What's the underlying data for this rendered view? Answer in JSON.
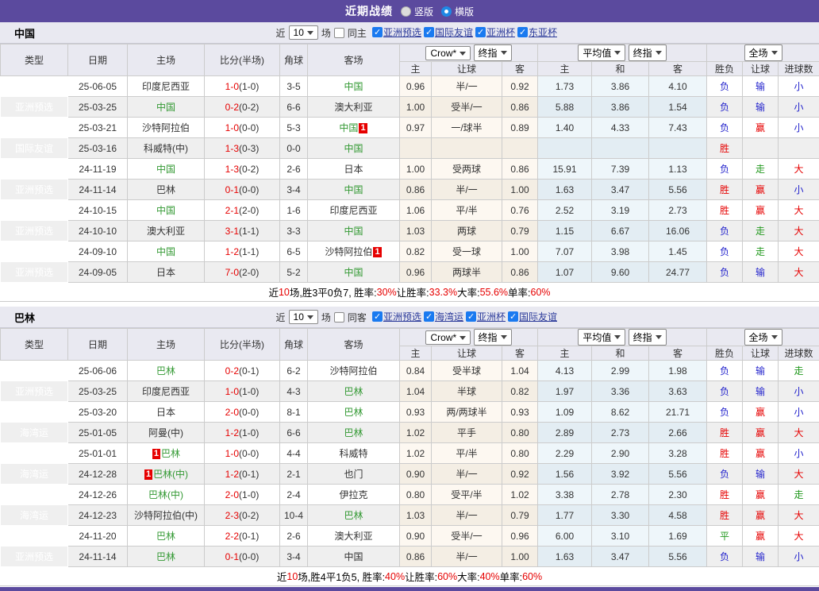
{
  "topbar": {
    "title": "近期战绩",
    "layout_options": [
      {
        "label": "竖版",
        "selected": false
      },
      {
        "label": "横版",
        "selected": true
      }
    ]
  },
  "labels": {
    "col_type": "类型",
    "col_date": "日期",
    "col_home": "主场",
    "col_score": "比分(半场)",
    "col_corner": "角球",
    "col_away": "客场",
    "odds_company_select": "Crow*",
    "odds_time_select": "终指",
    "avg_type_select": "平均值",
    "avg_time_select": "终指",
    "scope_select": "全场",
    "sub_home": "主",
    "sub_handicap": "让球",
    "sub_away": "客",
    "sub_avg_home": "主",
    "sub_avg_draw": "和",
    "sub_avg_away": "客",
    "res_outcome": "胜负",
    "res_handicap": "让球",
    "res_goals": "进球数"
  },
  "colors": {
    "header_purple": "#5b4a9e",
    "comp_green": "#4cae4c",
    "comp_blue": "#5b74bd",
    "comp_darkred": "#a52a2a",
    "team_green": "#339933",
    "win_red": "#e60000",
    "loss_blue": "#2222cc",
    "draw_green": "#22991e",
    "checkbox_blue": "#1a7af0"
  },
  "sections": [
    {
      "team": "中国",
      "filter": {
        "near": "近",
        "games": "10",
        "suffix": "场",
        "same_label": "同主",
        "same_checked": false,
        "competitions": [
          "亚洲预选",
          "国际友谊",
          "亚洲杯",
          "东亚杯"
        ]
      },
      "rows": [
        {
          "comp": "亚洲预选",
          "comp_color": "green",
          "date": "25-06-05",
          "home": {
            "name": "印度尼西亚",
            "hl": false
          },
          "score": "1-0",
          "half": "(1-0)",
          "corners": "3-5",
          "away": {
            "name": "中国",
            "hl": true
          },
          "odds": [
            "0.96",
            "半/一",
            "0.92"
          ],
          "avg": [
            "1.73",
            "3.86",
            "4.10"
          ],
          "results": [
            [
              "负",
              "b"
            ],
            [
              "输",
              "b"
            ],
            [
              "小",
              "b"
            ]
          ]
        },
        {
          "comp": "亚洲预选",
          "comp_color": "green",
          "date": "25-03-25",
          "home": {
            "name": "中国",
            "hl": true
          },
          "score": "0-2",
          "half": "(0-2)",
          "corners": "6-6",
          "away": {
            "name": "澳大利亚",
            "hl": false
          },
          "odds": [
            "1.00",
            "受半/一",
            "0.86"
          ],
          "avg": [
            "5.88",
            "3.86",
            "1.54"
          ],
          "results": [
            [
              "负",
              "b"
            ],
            [
              "输",
              "b"
            ],
            [
              "小",
              "b"
            ]
          ]
        },
        {
          "comp": "亚洲预选",
          "comp_color": "green",
          "date": "25-03-21",
          "home": {
            "name": "沙特阿拉伯",
            "hl": false
          },
          "score": "1-0",
          "half": "(0-0)",
          "corners": "5-3",
          "away": {
            "name": "中国",
            "hl": true,
            "badge": "1",
            "badge_pos": "after"
          },
          "odds": [
            "0.97",
            "一/球半",
            "0.89"
          ],
          "avg": [
            "1.40",
            "4.33",
            "7.43"
          ],
          "results": [
            [
              "负",
              "b"
            ],
            [
              "赢",
              "r"
            ],
            [
              "小",
              "b"
            ]
          ]
        },
        {
          "comp": "国际友谊",
          "comp_color": "blue",
          "date": "25-03-16",
          "home": {
            "name": "科威特(中)",
            "hl": false
          },
          "score": "1-3",
          "half": "(0-3)",
          "corners": "0-0",
          "away": {
            "name": "中国",
            "hl": true
          },
          "odds": [
            "",
            "",
            ""
          ],
          "avg": [
            "",
            "",
            ""
          ],
          "results": [
            [
              "胜",
              "r"
            ],
            [
              "",
              ""
            ],
            [
              "",
              ""
            ]
          ]
        },
        {
          "comp": "亚洲预选",
          "comp_color": "green",
          "date": "24-11-19",
          "home": {
            "name": "中国",
            "hl": true
          },
          "score": "1-3",
          "half": "(0-2)",
          "corners": "2-6",
          "away": {
            "name": "日本",
            "hl": false
          },
          "odds": [
            "1.00",
            "受两球",
            "0.86"
          ],
          "avg": [
            "15.91",
            "7.39",
            "1.13"
          ],
          "results": [
            [
              "负",
              "b"
            ],
            [
              "走",
              "g"
            ],
            [
              "大",
              "r"
            ]
          ]
        },
        {
          "comp": "亚洲预选",
          "comp_color": "green",
          "date": "24-11-14",
          "home": {
            "name": "巴林",
            "hl": false
          },
          "score": "0-1",
          "half": "(0-0)",
          "corners": "3-4",
          "away": {
            "name": "中国",
            "hl": true
          },
          "odds": [
            "0.86",
            "半/一",
            "1.00"
          ],
          "avg": [
            "1.63",
            "3.47",
            "5.56"
          ],
          "results": [
            [
              "胜",
              "r"
            ],
            [
              "赢",
              "r"
            ],
            [
              "小",
              "b"
            ]
          ]
        },
        {
          "comp": "亚洲预选",
          "comp_color": "green",
          "date": "24-10-15",
          "home": {
            "name": "中国",
            "hl": true
          },
          "score": "2-1",
          "half": "(2-0)",
          "corners": "1-6",
          "away": {
            "name": "印度尼西亚",
            "hl": false
          },
          "odds": [
            "1.06",
            "平/半",
            "0.76"
          ],
          "avg": [
            "2.52",
            "3.19",
            "2.73"
          ],
          "results": [
            [
              "胜",
              "r"
            ],
            [
              "赢",
              "r"
            ],
            [
              "大",
              "r"
            ]
          ]
        },
        {
          "comp": "亚洲预选",
          "comp_color": "green",
          "date": "24-10-10",
          "home": {
            "name": "澳大利亚",
            "hl": false
          },
          "score": "3-1",
          "half": "(1-1)",
          "corners": "3-3",
          "away": {
            "name": "中国",
            "hl": true
          },
          "odds": [
            "1.03",
            "两球",
            "0.79"
          ],
          "avg": [
            "1.15",
            "6.67",
            "16.06"
          ],
          "results": [
            [
              "负",
              "b"
            ],
            [
              "走",
              "g"
            ],
            [
              "大",
              "r"
            ]
          ]
        },
        {
          "comp": "亚洲预选",
          "comp_color": "green",
          "date": "24-09-10",
          "home": {
            "name": "中国",
            "hl": true
          },
          "score": "1-2",
          "half": "(1-1)",
          "corners": "6-5",
          "away": {
            "name": "沙特阿拉伯",
            "hl": false,
            "badge": "1",
            "badge_pos": "after"
          },
          "odds": [
            "0.82",
            "受一球",
            "1.00"
          ],
          "avg": [
            "7.07",
            "3.98",
            "1.45"
          ],
          "results": [
            [
              "负",
              "b"
            ],
            [
              "走",
              "g"
            ],
            [
              "大",
              "r"
            ]
          ]
        },
        {
          "comp": "亚洲预选",
          "comp_color": "green",
          "date": "24-09-05",
          "home": {
            "name": "日本",
            "hl": false
          },
          "score": "7-0",
          "half": "(2-0)",
          "corners": "5-2",
          "away": {
            "name": "中国",
            "hl": true
          },
          "odds": [
            "0.96",
            "两球半",
            "0.86"
          ],
          "avg": [
            "1.07",
            "9.60",
            "24.77"
          ],
          "results": [
            [
              "负",
              "b"
            ],
            [
              "输",
              "b"
            ],
            [
              "大",
              "r"
            ]
          ]
        }
      ],
      "summary": [
        [
          "近",
          "k"
        ],
        [
          "10",
          "r"
        ],
        [
          "场,胜3平0负7, 胜率:",
          "k"
        ],
        [
          "30%",
          "r"
        ],
        [
          " 让胜率:",
          "k"
        ],
        [
          "33.3%",
          "r"
        ],
        [
          " 大率:",
          "k"
        ],
        [
          "55.6%",
          "r"
        ],
        [
          " 单率:",
          "k"
        ],
        [
          "60%",
          "r"
        ]
      ]
    },
    {
      "team": "巴林",
      "filter": {
        "near": "近",
        "games": "10",
        "suffix": "场",
        "same_label": "同客",
        "same_checked": false,
        "competitions": [
          "亚洲预选",
          "海湾运",
          "亚洲杯",
          "国际友谊"
        ]
      },
      "rows": [
        {
          "comp": "亚洲预选",
          "comp_color": "green",
          "date": "25-06-06",
          "home": {
            "name": "巴林",
            "hl": true
          },
          "score": "0-2",
          "half": "(0-1)",
          "corners": "6-2",
          "away": {
            "name": "沙特阿拉伯",
            "hl": false
          },
          "odds": [
            "0.84",
            "受半球",
            "1.04"
          ],
          "avg": [
            "4.13",
            "2.99",
            "1.98"
          ],
          "results": [
            [
              "负",
              "b"
            ],
            [
              "输",
              "b"
            ],
            [
              "走",
              "g"
            ]
          ]
        },
        {
          "comp": "亚洲预选",
          "comp_color": "green",
          "date": "25-03-25",
          "home": {
            "name": "印度尼西亚",
            "hl": false
          },
          "score": "1-0",
          "half": "(1-0)",
          "corners": "4-3",
          "away": {
            "name": "巴林",
            "hl": true
          },
          "odds": [
            "1.04",
            "半球",
            "0.82"
          ],
          "avg": [
            "1.97",
            "3.36",
            "3.63"
          ],
          "results": [
            [
              "负",
              "b"
            ],
            [
              "输",
              "b"
            ],
            [
              "小",
              "b"
            ]
          ]
        },
        {
          "comp": "亚洲预选",
          "comp_color": "green",
          "date": "25-03-20",
          "home": {
            "name": "日本",
            "hl": false
          },
          "score": "2-0",
          "half": "(0-0)",
          "corners": "8-1",
          "away": {
            "name": "巴林",
            "hl": true
          },
          "odds": [
            "0.93",
            "两/两球半",
            "0.93"
          ],
          "avg": [
            "1.09",
            "8.62",
            "21.71"
          ],
          "results": [
            [
              "负",
              "b"
            ],
            [
              "赢",
              "r"
            ],
            [
              "小",
              "b"
            ]
          ]
        },
        {
          "comp": "海湾运",
          "comp_color": "darkred",
          "date": "25-01-05",
          "home": {
            "name": "阿曼(中)",
            "hl": false
          },
          "score": "1-2",
          "half": "(1-0)",
          "corners": "6-6",
          "away": {
            "name": "巴林",
            "hl": true
          },
          "odds": [
            "1.02",
            "平手",
            "0.80"
          ],
          "avg": [
            "2.89",
            "2.73",
            "2.66"
          ],
          "results": [
            [
              "胜",
              "r"
            ],
            [
              "赢",
              "r"
            ],
            [
              "大",
              "r"
            ]
          ]
        },
        {
          "comp": "海湾运",
          "comp_color": "darkred",
          "date": "25-01-01",
          "home": {
            "name": "巴林",
            "hl": true,
            "badge": "1",
            "badge_pos": "before"
          },
          "score": "1-0",
          "half": "(0-0)",
          "corners": "4-4",
          "away": {
            "name": "科威特",
            "hl": false
          },
          "odds": [
            "1.02",
            "平/半",
            "0.80"
          ],
          "avg": [
            "2.29",
            "2.90",
            "3.28"
          ],
          "results": [
            [
              "胜",
              "r"
            ],
            [
              "赢",
              "r"
            ],
            [
              "小",
              "b"
            ]
          ]
        },
        {
          "comp": "海湾运",
          "comp_color": "darkred",
          "date": "24-12-28",
          "home": {
            "name": "巴林(中)",
            "hl": true,
            "badge": "1",
            "badge_pos": "before"
          },
          "score": "1-2",
          "half": "(0-1)",
          "corners": "2-1",
          "away": {
            "name": "也门",
            "hl": false
          },
          "odds": [
            "0.90",
            "半/一",
            "0.92"
          ],
          "avg": [
            "1.56",
            "3.92",
            "5.56"
          ],
          "results": [
            [
              "负",
              "b"
            ],
            [
              "输",
              "b"
            ],
            [
              "大",
              "r"
            ]
          ]
        },
        {
          "comp": "海湾运",
          "comp_color": "darkred",
          "date": "24-12-26",
          "home": {
            "name": "巴林(中)",
            "hl": true
          },
          "score": "2-0",
          "half": "(1-0)",
          "corners": "2-4",
          "away": {
            "name": "伊拉克",
            "hl": false
          },
          "odds": [
            "0.80",
            "受平/半",
            "1.02"
          ],
          "avg": [
            "3.38",
            "2.78",
            "2.30"
          ],
          "results": [
            [
              "胜",
              "r"
            ],
            [
              "赢",
              "r"
            ],
            [
              "走",
              "g"
            ]
          ]
        },
        {
          "comp": "海湾运",
          "comp_color": "darkred",
          "date": "24-12-23",
          "home": {
            "name": "沙特阿拉伯(中)",
            "hl": false
          },
          "score": "2-3",
          "half": "(0-2)",
          "corners": "10-4",
          "away": {
            "name": "巴林",
            "hl": true
          },
          "odds": [
            "1.03",
            "半/一",
            "0.79"
          ],
          "avg": [
            "1.77",
            "3.30",
            "4.58"
          ],
          "results": [
            [
              "胜",
              "r"
            ],
            [
              "赢",
              "r"
            ],
            [
              "大",
              "r"
            ]
          ]
        },
        {
          "comp": "亚洲预选",
          "comp_color": "green",
          "date": "24-11-20",
          "home": {
            "name": "巴林",
            "hl": true
          },
          "score": "2-2",
          "half": "(0-1)",
          "corners": "2-6",
          "away": {
            "name": "澳大利亚",
            "hl": false
          },
          "odds": [
            "0.90",
            "受半/一",
            "0.96"
          ],
          "avg": [
            "6.00",
            "3.10",
            "1.69"
          ],
          "results": [
            [
              "平",
              "g"
            ],
            [
              "赢",
              "r"
            ],
            [
              "大",
              "r"
            ]
          ]
        },
        {
          "comp": "亚洲预选",
          "comp_color": "green",
          "date": "24-11-14",
          "home": {
            "name": "巴林",
            "hl": true
          },
          "score": "0-1",
          "half": "(0-0)",
          "corners": "3-4",
          "away": {
            "name": "中国",
            "hl": false
          },
          "odds": [
            "0.86",
            "半/一",
            "1.00"
          ],
          "avg": [
            "1.63",
            "3.47",
            "5.56"
          ],
          "results": [
            [
              "负",
              "b"
            ],
            [
              "输",
              "b"
            ],
            [
              "小",
              "b"
            ]
          ]
        }
      ],
      "summary": [
        [
          "近",
          "k"
        ],
        [
          "10",
          "r"
        ],
        [
          "场,胜4平1负5, 胜率:",
          "k"
        ],
        [
          "40%",
          "r"
        ],
        [
          " 让胜率:",
          "k"
        ],
        [
          "60%",
          "r"
        ],
        [
          " 大率:",
          "k"
        ],
        [
          "40%",
          "r"
        ],
        [
          " 单率:",
          "k"
        ],
        [
          "60%",
          "r"
        ]
      ]
    }
  ]
}
